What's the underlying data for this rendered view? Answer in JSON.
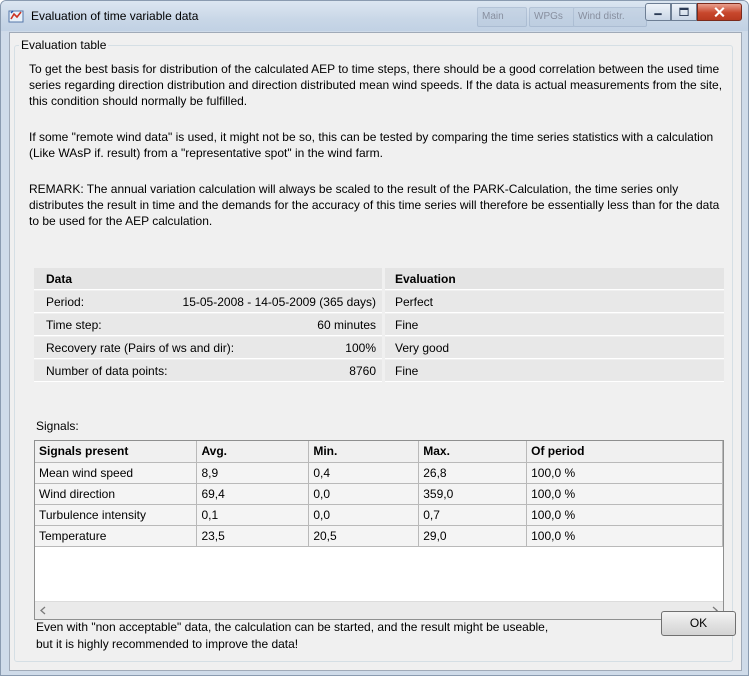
{
  "window": {
    "title": "Evaluation of time variable data",
    "background_tabs": [
      "Main",
      "WPGs",
      "Wind distr."
    ]
  },
  "group": {
    "legend": "Evaluation table",
    "paragraphs": [
      "To get the best basis for distribution of the calculated AEP to time steps, there should be a good correlation between the used time series regarding direction distribution and direction distributed mean wind speeds. If the data is actual measurements from the site, this condition should normally be fulfilled.",
      "If some \"remote wind data\" is used, it might not be so, this can be tested by comparing the time series statistics with a calculation (Like WAsP if. result) from a \"representative spot\" in the wind farm.",
      "REMARK: The annual variation calculation will always be scaled to the result of the PARK-Calculation, the time series only distributes the result in time and the demands for the accuracy of this time series will therefore be essentially less than for the data to be used for the AEP calculation."
    ]
  },
  "data_table": {
    "header_left": "Data",
    "header_right": "Evaluation",
    "rows": [
      {
        "label": "Period:",
        "value": "15-05-2008 - 14-05-2009 (365 days)",
        "evaluation": "Perfect"
      },
      {
        "label": "Time step:",
        "value": "60 minutes",
        "evaluation": "Fine"
      },
      {
        "label": "Recovery rate (Pairs of ws and dir):",
        "value": "100%",
        "evaluation": "Very good"
      },
      {
        "label": "Number of data points:",
        "value": "8760",
        "evaluation": "Fine"
      }
    ]
  },
  "signals": {
    "label": "Signals:",
    "columns": [
      "Signals present",
      "Avg.",
      "Min.",
      "Max.",
      "Of period"
    ],
    "rows": [
      [
        "Mean wind speed",
        "8,9",
        "0,4",
        "26,8",
        "100,0 %"
      ],
      [
        "Wind direction",
        "69,4",
        "0,0",
        "359,0",
        "100,0 %"
      ],
      [
        "Turbulence intensity",
        "0,1",
        "0,0",
        "0,7",
        "100,0 %"
      ],
      [
        "Temperature",
        "23,5",
        "20,5",
        "29,0",
        "100,0 %"
      ]
    ]
  },
  "footer": {
    "line1": "Even with \"non acceptable\" data, the calculation can be started, and the result might be useable,",
    "line2": "but it is highly recommended to improve the data!",
    "ok_label": "OK"
  },
  "colors": {
    "title_bar": "#c9d7e7",
    "close_button": "#c8472c",
    "dialog_bg": "#f0f0f0"
  }
}
